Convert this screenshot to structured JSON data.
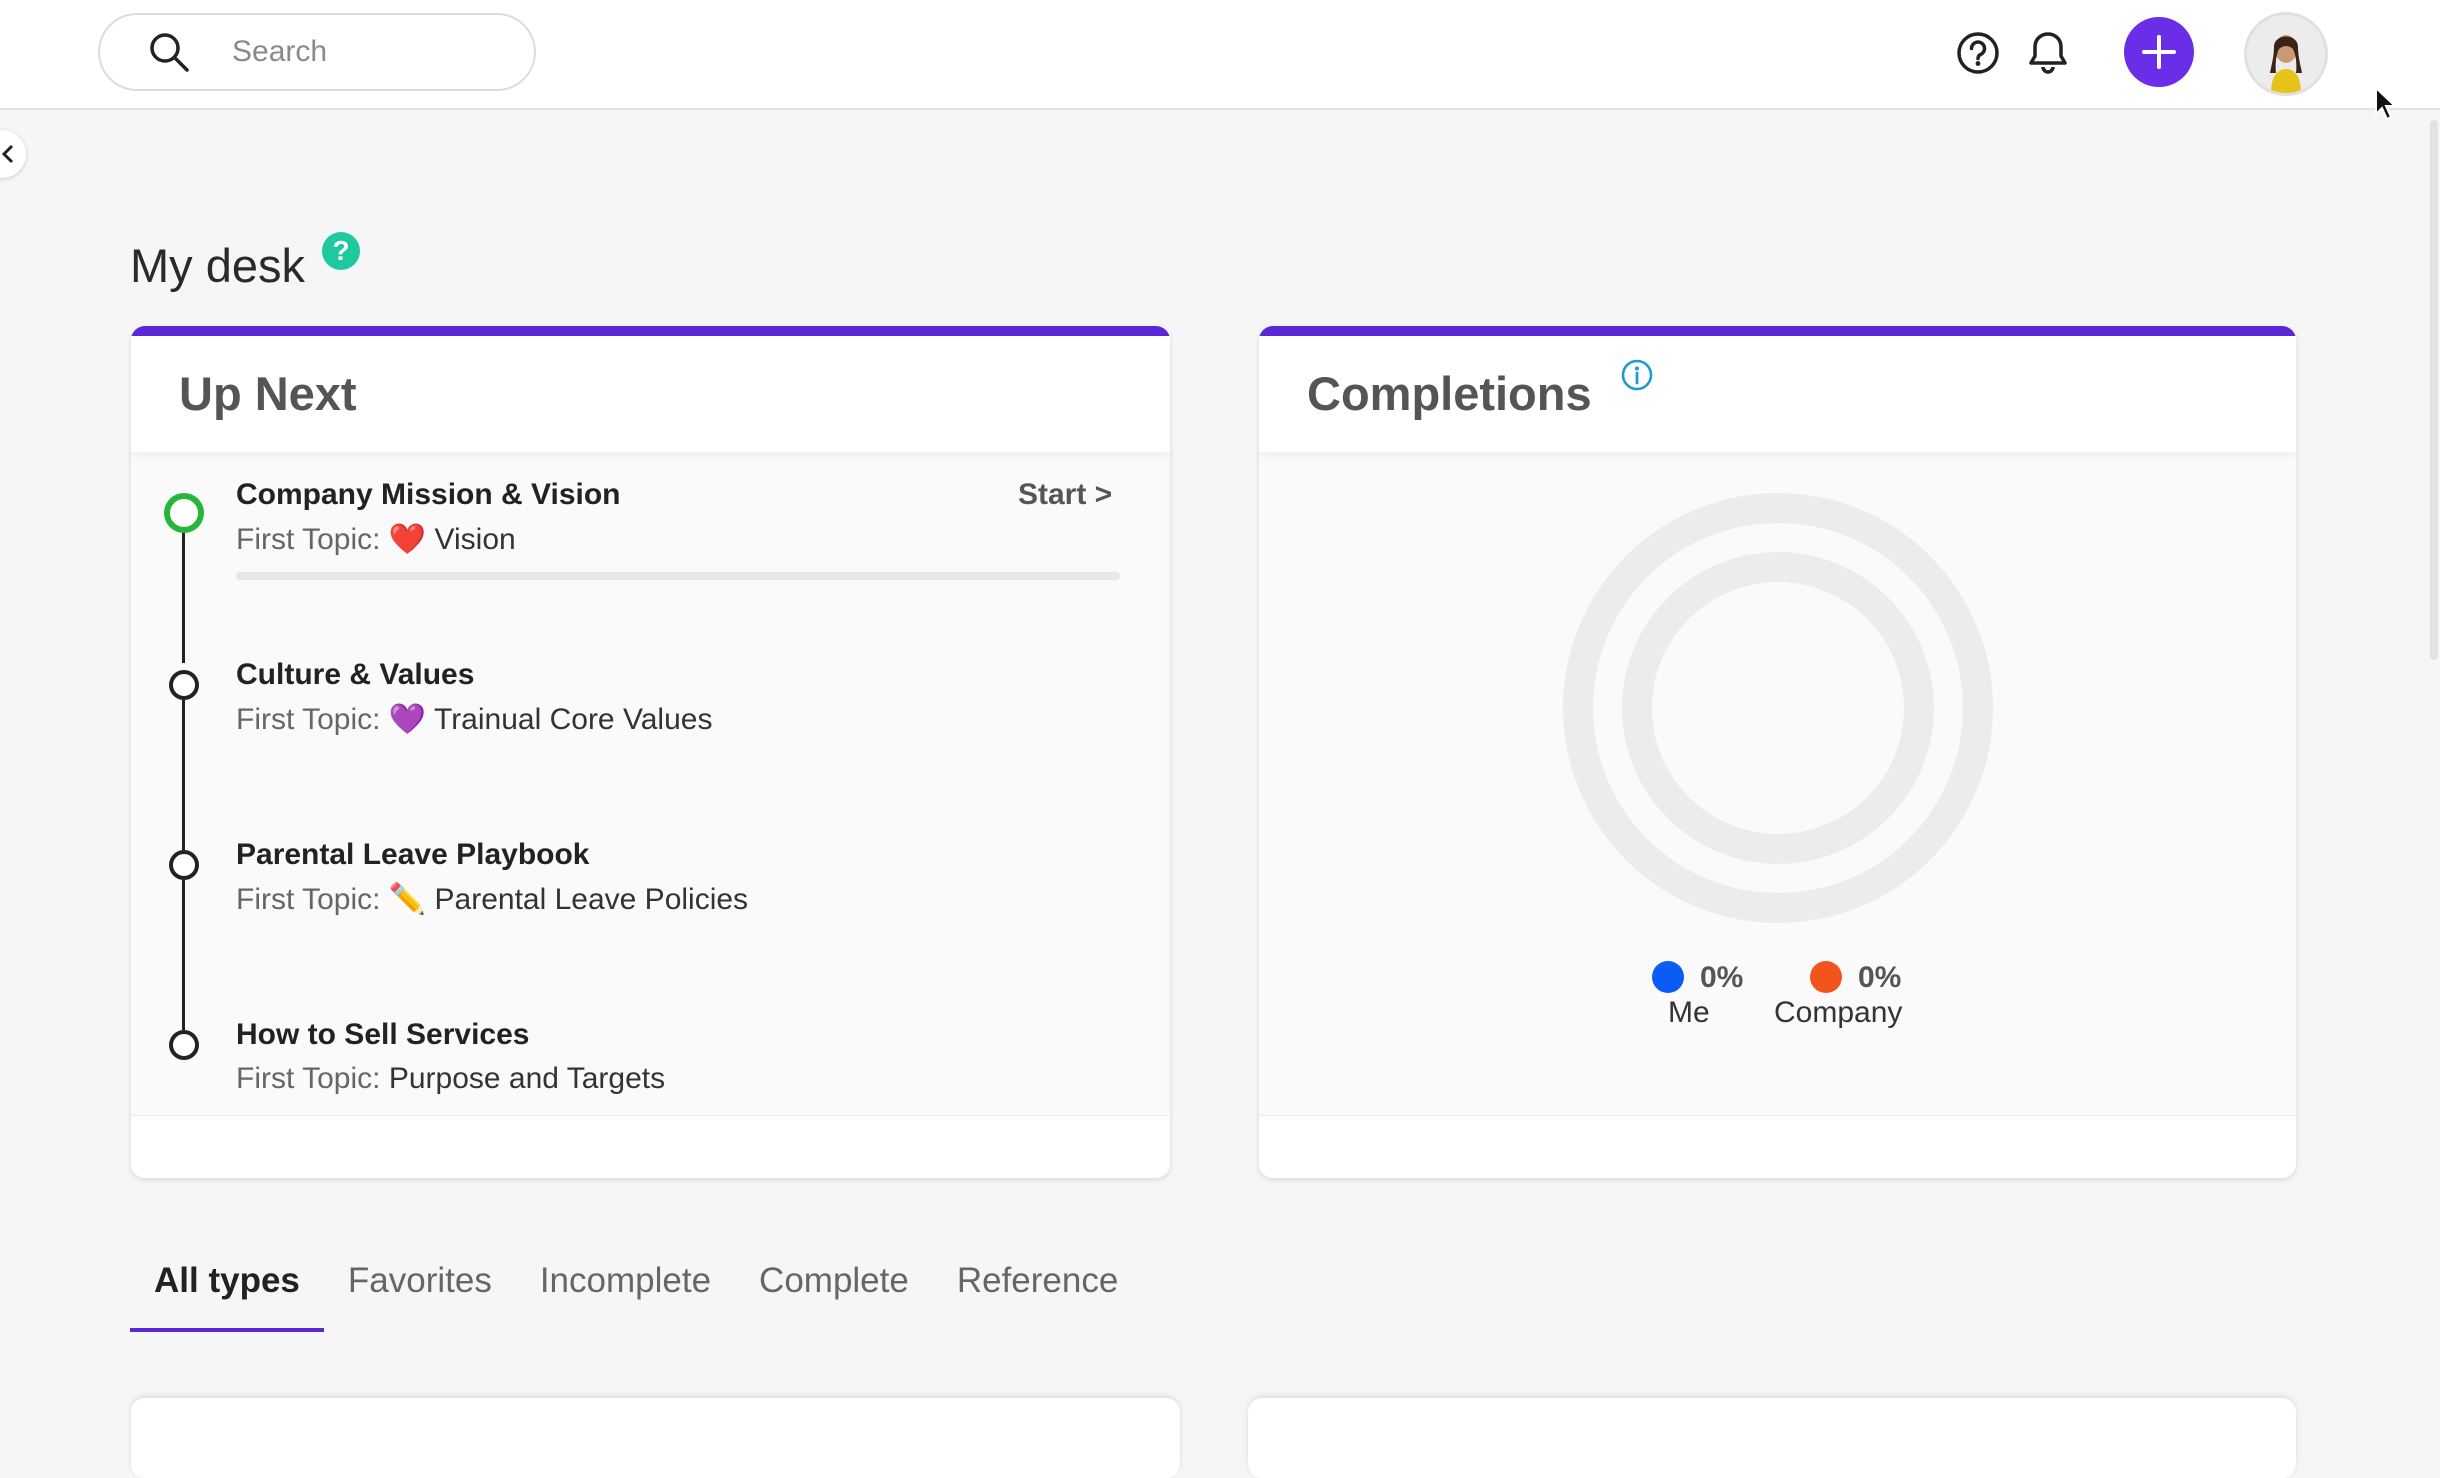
{
  "header": {
    "search_placeholder": "Search",
    "icons": [
      "search-icon",
      "help-icon",
      "bell-icon",
      "plus-icon",
      "avatar"
    ],
    "accent_color": "#6a2ee8"
  },
  "page": {
    "title": "My desk"
  },
  "up_next": {
    "title": "Up Next",
    "start_label": "Start >",
    "first_topic_label": "First Topic:",
    "items": [
      {
        "title": "Company Mission & Vision",
        "topic": "Vision",
        "emoji": "❤️",
        "progress": 0
      },
      {
        "title": "Culture & Values",
        "topic": "Trainual Core Values",
        "emoji": "💜"
      },
      {
        "title": "Parental Leave Playbook",
        "topic": "Parental Leave Policies",
        "emoji": "✏️"
      },
      {
        "title": "How to Sell Services",
        "topic": "Purpose and Targets",
        "emoji": ""
      }
    ]
  },
  "completions": {
    "title": "Completions",
    "legend": [
      {
        "name": "Me",
        "value": "0%",
        "color": "#0a5cf5"
      },
      {
        "name": "Company",
        "value": "0%",
        "color": "#f2541b"
      }
    ]
  },
  "chart_data": {
    "type": "pie",
    "series": [
      {
        "name": "Me",
        "values": [
          0
        ]
      },
      {
        "name": "Company",
        "values": [
          0
        ]
      }
    ]
  },
  "tabs": [
    {
      "label": "All types",
      "active": true
    },
    {
      "label": "Favorites",
      "active": false
    },
    {
      "label": "Incomplete",
      "active": false
    },
    {
      "label": "Complete",
      "active": false
    },
    {
      "label": "Reference",
      "active": false
    }
  ]
}
